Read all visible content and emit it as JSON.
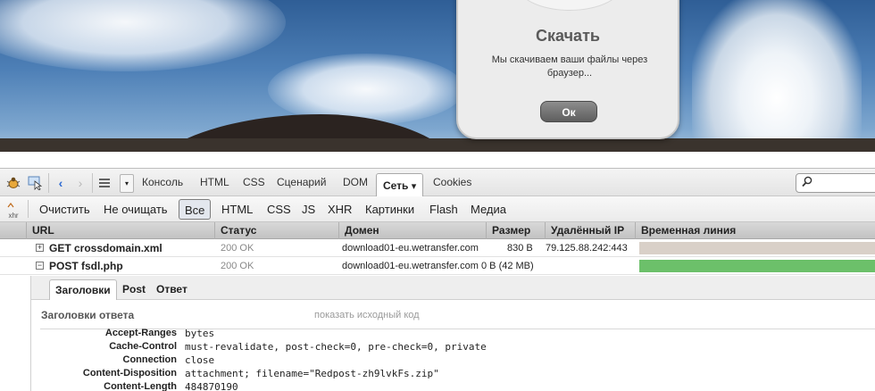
{
  "dialog": {
    "title": "Скачать",
    "message": "Мы скачиваем ваши файлы через браузер...",
    "ok_label": "Ок"
  },
  "firebug": {
    "toolbar": {
      "tabs": [
        "Консоль",
        "HTML",
        "CSS",
        "Сценарий",
        "DOM",
        "Сеть",
        "Cookies"
      ],
      "active_tab": "Сеть",
      "active_arrow": "▾"
    },
    "filters": {
      "xhr_icon_label": "xhr",
      "clear_label": "Очистить",
      "persist_label": "Не очищать",
      "items": [
        "Все",
        "HTML",
        "CSS",
        "JS",
        "XHR",
        "Картинки",
        "Flash",
        "Медиа"
      ],
      "active": "Все"
    },
    "columns": [
      "URL",
      "Статус",
      "Домен",
      "Размер",
      "Удалённый IP",
      "Временная линия"
    ],
    "requests": [
      {
        "expander": "+",
        "url": "GET crossdomain.xml",
        "status": "200 OK",
        "domain": "download01-eu.wetransfer.com",
        "size": "830 B",
        "remote_ip": "79.125.88.242:443",
        "timeline_color": "#d9d0c8"
      },
      {
        "expander": "−",
        "url": "POST fsdl.php",
        "status": "200 OK",
        "domain": "download01-eu.wetransfer.com",
        "size": "0 B (42 MB)",
        "remote_ip": "",
        "timeline_color": "#6cc06a"
      }
    ],
    "details": {
      "tabs": [
        "Заголовки",
        "Post",
        "Ответ"
      ],
      "active_tab": "Заголовки",
      "section_title": "Заголовки ответа",
      "show_source": "показать исходный код",
      "headers": [
        {
          "name": "Accept-Ranges",
          "value": "bytes"
        },
        {
          "name": "Cache-Control",
          "value": "must-revalidate, post-check=0, pre-check=0, private"
        },
        {
          "name": "Connection",
          "value": "close"
        },
        {
          "name": "Content-Disposition",
          "value": "attachment; filename=\"Redpost-zh9lvkFs.zip\""
        },
        {
          "name": "Content-Length",
          "value": "484870190"
        }
      ]
    }
  }
}
